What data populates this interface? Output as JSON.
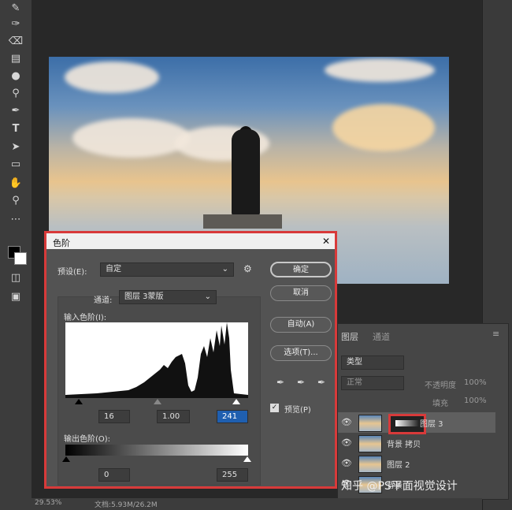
{
  "photoshop": {
    "status_zoom": "29.53%",
    "status_doc": "文档:5.93M/26.2M",
    "watermark": "知乎 @PS平面视觉设计"
  },
  "toolbar": {
    "tools": [
      "brush-icon",
      "healing-icon",
      "eraser-icon",
      "gradient-icon",
      "blur-icon",
      "dodge-icon",
      "pen-icon",
      "type-icon",
      "path-select-icon",
      "rectangle-icon",
      "hand-icon",
      "zoom-icon",
      "more-icon"
    ]
  },
  "dialog": {
    "title": "色阶",
    "close": "✕",
    "preset_label": "预设(E):",
    "preset_value": "自定",
    "channel_label": "通道:",
    "channel_value": "图层 3蒙版",
    "input_label": "输入色阶(I):",
    "input_black": "16",
    "input_gamma": "1.00",
    "input_white": "241",
    "output_label": "输出色阶(O):",
    "output_black": "0",
    "output_white": "255",
    "ok": "确定",
    "cancel": "取消",
    "auto": "自动(A)",
    "options": "选项(T)...",
    "preview": "预览(P)",
    "preview_checked": true
  },
  "layers": {
    "tab_layers": "图层",
    "tab_channels": "通道",
    "filter_kind": "类型",
    "blend_mode": "正常",
    "opacity_label": "不透明度",
    "opacity_value": "100%",
    "fill_label": "填充",
    "fill_value": "100%",
    "items": [
      {
        "name": "图层 3"
      },
      {
        "name": "背景 拷贝"
      },
      {
        "name": "图层 2"
      },
      {
        "name": "背景"
      }
    ]
  }
}
